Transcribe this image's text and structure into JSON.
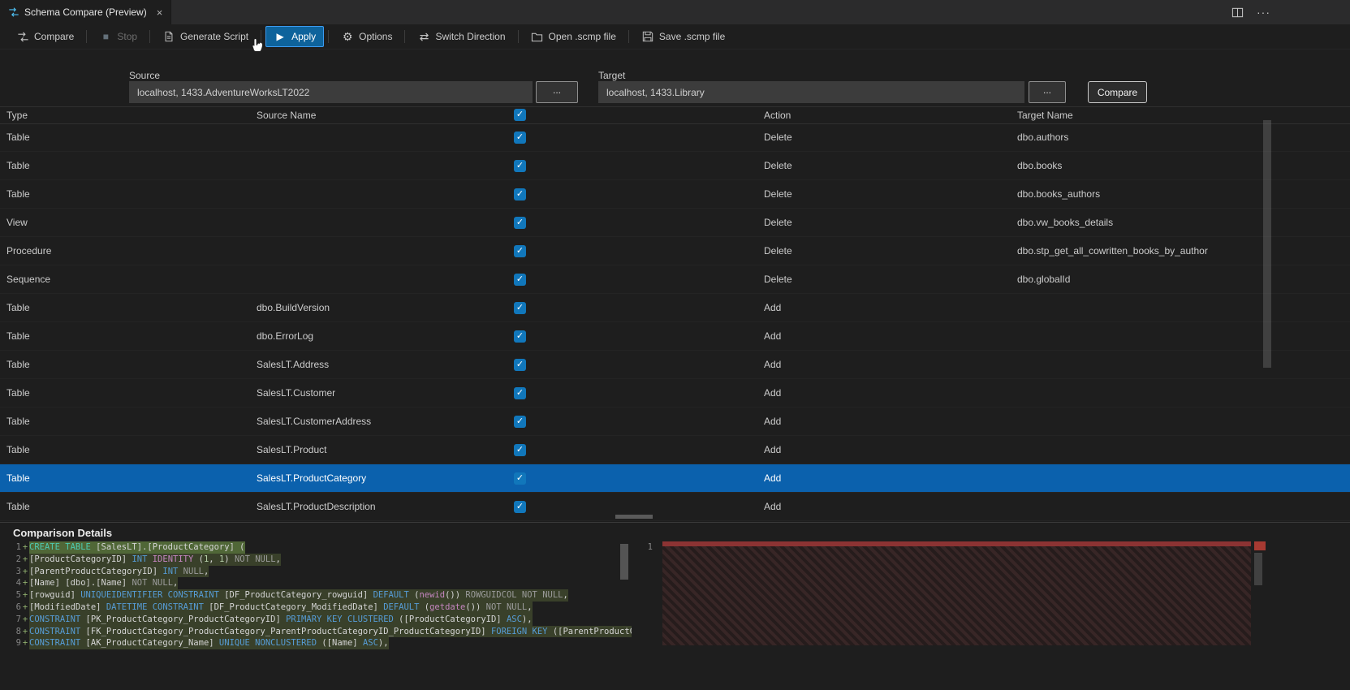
{
  "tab": {
    "title": "Schema Compare (Preview)",
    "close_glyph": "×"
  },
  "icons": {
    "play": "▶",
    "stop": "■",
    "gear": "⚙",
    "switch_arrows": "⇄",
    "more": "···",
    "check": "✓"
  },
  "toolbar": {
    "items": [
      {
        "label": "Compare"
      },
      {
        "label": "Stop"
      },
      {
        "label": "Generate Script"
      },
      {
        "label": "Apply"
      },
      {
        "label": "Options"
      },
      {
        "label": "Switch Direction"
      },
      {
        "label": "Open .scmp file"
      },
      {
        "label": "Save .scmp file"
      }
    ]
  },
  "connections": {
    "source_label": "Source",
    "source_value": "localhost, 1433.AdventureWorksLT2022",
    "target_label": "Target",
    "target_value": "localhost, 1433.Library",
    "browse_label": "...",
    "compare_button": "Compare"
  },
  "grid": {
    "columns": {
      "type": "Type",
      "source": "Source Name",
      "action": "Action",
      "target": "Target Name"
    },
    "header_checkbox_checked": true,
    "selected_index": 12,
    "rows": [
      {
        "type": "Table",
        "source": "",
        "checked": true,
        "action": "Delete",
        "target": "dbo.authors"
      },
      {
        "type": "Table",
        "source": "",
        "checked": true,
        "action": "Delete",
        "target": "dbo.books"
      },
      {
        "type": "Table",
        "source": "",
        "checked": true,
        "action": "Delete",
        "target": "dbo.books_authors"
      },
      {
        "type": "View",
        "source": "",
        "checked": true,
        "action": "Delete",
        "target": "dbo.vw_books_details"
      },
      {
        "type": "Procedure",
        "source": "",
        "checked": true,
        "action": "Delete",
        "target": "dbo.stp_get_all_cowritten_books_by_author"
      },
      {
        "type": "Sequence",
        "source": "",
        "checked": true,
        "action": "Delete",
        "target": "dbo.globalId"
      },
      {
        "type": "Table",
        "source": "dbo.BuildVersion",
        "checked": true,
        "action": "Add",
        "target": ""
      },
      {
        "type": "Table",
        "source": "dbo.ErrorLog",
        "checked": true,
        "action": "Add",
        "target": ""
      },
      {
        "type": "Table",
        "source": "SalesLT.Address",
        "checked": true,
        "action": "Add",
        "target": ""
      },
      {
        "type": "Table",
        "source": "SalesLT.Customer",
        "checked": true,
        "action": "Add",
        "target": ""
      },
      {
        "type": "Table",
        "source": "SalesLT.CustomerAddress",
        "checked": true,
        "action": "Add",
        "target": ""
      },
      {
        "type": "Table",
        "source": "SalesLT.Product",
        "checked": true,
        "action": "Add",
        "target": ""
      },
      {
        "type": "Table",
        "source": "SalesLT.ProductCategory",
        "checked": true,
        "action": "Add",
        "target": ""
      },
      {
        "type": "Table",
        "source": "SalesLT.ProductDescription",
        "checked": true,
        "action": "Add",
        "target": ""
      }
    ]
  },
  "details": {
    "title": "Comparison Details",
    "left": {
      "lines": [
        {
          "num": "1",
          "marker": "+",
          "strong": true,
          "segments": [
            [
              "g",
              "CREATE TABLE"
            ],
            [
              "d",
              " [SalesLT].[ProductCategory] ("
            ]
          ]
        },
        {
          "num": "2",
          "marker": "+",
          "segments": [
            [
              "d",
              "[ProductCategoryID] "
            ],
            [
              "k",
              "INT "
            ],
            [
              "m",
              "IDENTITY "
            ],
            [
              "d",
              "("
            ],
            [
              "n",
              "1"
            ],
            [
              "d",
              ", "
            ],
            [
              "n",
              "1"
            ],
            [
              "d",
              ") "
            ],
            [
              "dim",
              "NOT NULL"
            ],
            [
              "d",
              ","
            ]
          ]
        },
        {
          "num": "3",
          "marker": "+",
          "segments": [
            [
              "d",
              "[ParentProductCategoryID] "
            ],
            [
              "k",
              "INT "
            ],
            [
              "dim",
              "NULL"
            ],
            [
              "d",
              ","
            ]
          ]
        },
        {
          "num": "4",
          "marker": "+",
          "segments": [
            [
              "d",
              "[Name] [dbo].[Name] "
            ],
            [
              "dim",
              "NOT NULL"
            ],
            [
              "d",
              ","
            ]
          ]
        },
        {
          "num": "5",
          "marker": "+",
          "segments": [
            [
              "d",
              "[rowguid] "
            ],
            [
              "k",
              "UNIQUEIDENTIFIER CONSTRAINT "
            ],
            [
              "d",
              "[DF_ProductCategory_rowguid] "
            ],
            [
              "k",
              "DEFAULT "
            ],
            [
              "d",
              "("
            ],
            [
              "m",
              "newid"
            ],
            [
              "d",
              "()) "
            ],
            [
              "dim",
              "ROWGUIDCOL NOT NULL"
            ],
            [
              "d",
              ","
            ]
          ]
        },
        {
          "num": "6",
          "marker": "+",
          "segments": [
            [
              "d",
              "[ModifiedDate] "
            ],
            [
              "k",
              "DATETIME CONSTRAINT "
            ],
            [
              "d",
              "[DF_ProductCategory_ModifiedDate] "
            ],
            [
              "k",
              "DEFAULT "
            ],
            [
              "d",
              "("
            ],
            [
              "m",
              "getdate"
            ],
            [
              "d",
              "()) "
            ],
            [
              "dim",
              "NOT NULL"
            ],
            [
              "d",
              ","
            ]
          ]
        },
        {
          "num": "7",
          "marker": "+",
          "segments": [
            [
              "k",
              "CONSTRAINT "
            ],
            [
              "d",
              "[PK_ProductCategory_ProductCategoryID] "
            ],
            [
              "k",
              "PRIMARY KEY CLUSTERED "
            ],
            [
              "d",
              "([ProductCategoryID] "
            ],
            [
              "k",
              "ASC"
            ],
            [
              "d",
              "),"
            ]
          ]
        },
        {
          "num": "8",
          "marker": "+",
          "segments": [
            [
              "k",
              "CONSTRAINT "
            ],
            [
              "d",
              "[FK_ProductCategory_ProductCategory_ParentProductCategoryID_ProductCategoryID] "
            ],
            [
              "k",
              "FOREIGN KEY "
            ],
            [
              "d",
              "([ParentProductCatego"
            ]
          ]
        },
        {
          "num": "9",
          "marker": "+",
          "segments": [
            [
              "k",
              "CONSTRAINT "
            ],
            [
              "d",
              "[AK_ProductCategory_Name] "
            ],
            [
              "k",
              "UNIQUE NONCLUSTERED "
            ],
            [
              "d",
              "([Name] "
            ],
            [
              "k",
              "ASC"
            ],
            [
              "d",
              "),"
            ]
          ]
        }
      ]
    },
    "right": {
      "first_line_number": "1"
    }
  }
}
